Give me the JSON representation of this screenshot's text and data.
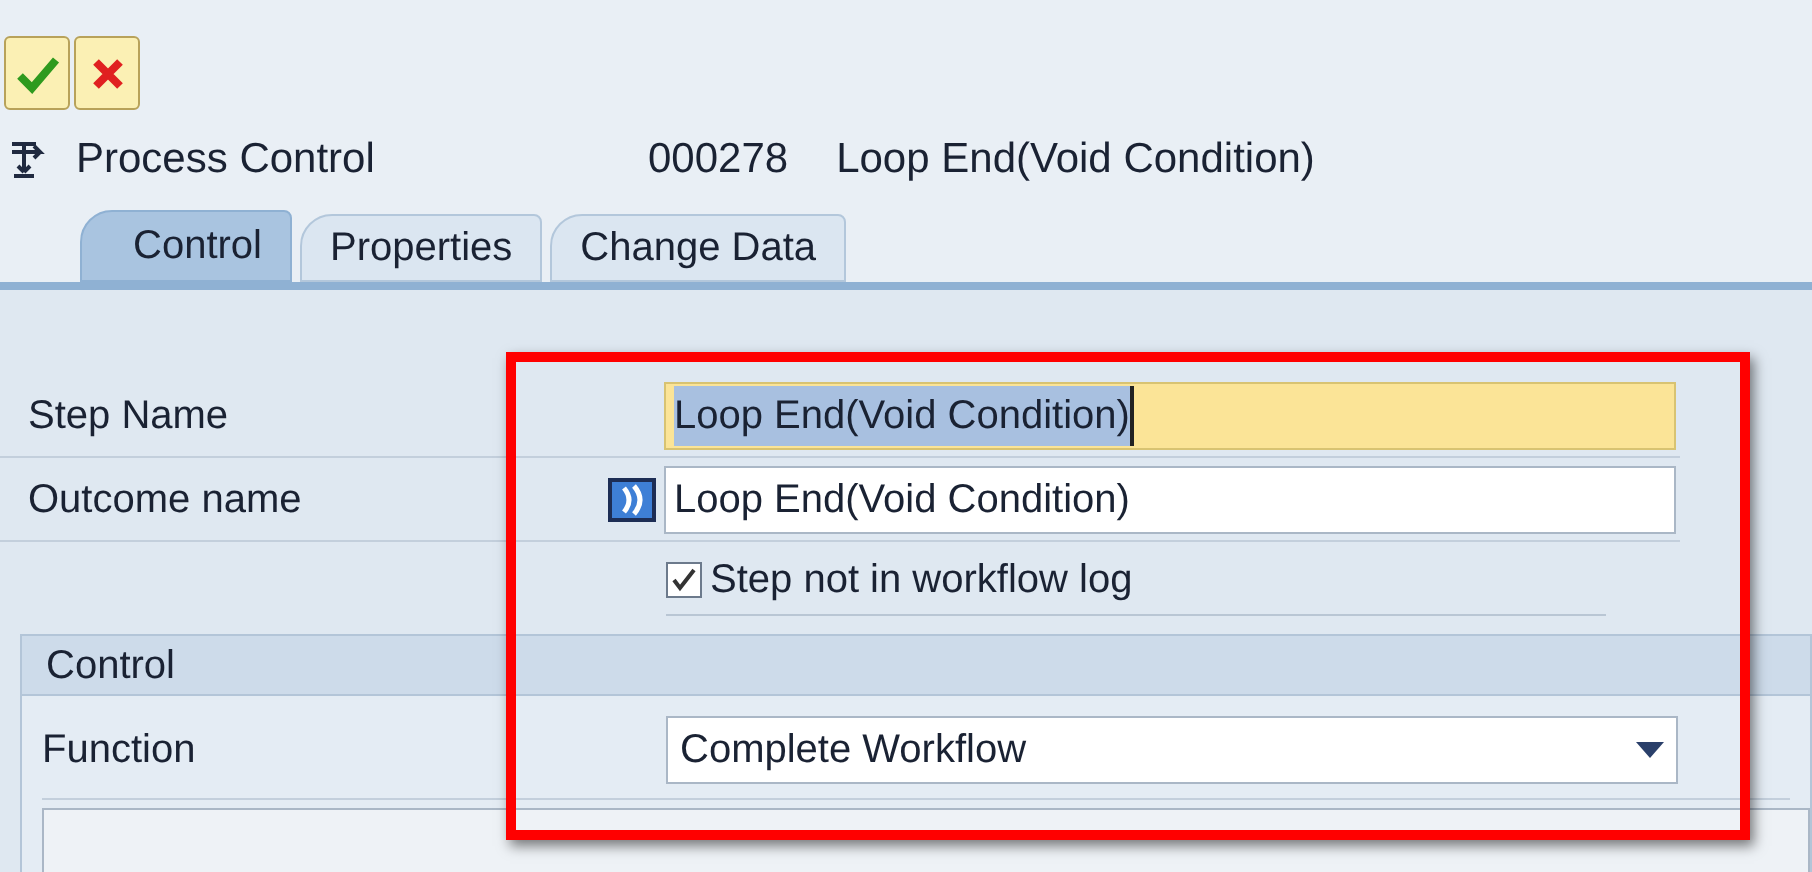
{
  "toolbar_buttons": [
    {
      "kind": "confirm"
    },
    {
      "kind": "cancel"
    }
  ],
  "header": {
    "title": "Process Control",
    "step_number": "000278",
    "step_title": "Loop End(Void Condition)"
  },
  "tabs": [
    {
      "label": "Control",
      "selected": true
    },
    {
      "label": "Properties",
      "selected": false
    },
    {
      "label": "Change Data",
      "selected": false
    }
  ],
  "fields": [
    {
      "label": "Step Name",
      "value": "Loop End(Void Condition)",
      "focused": true,
      "outcome_icon": false
    },
    {
      "label": "Outcome name",
      "value": "Loop End(Void Condition)",
      "focused": false,
      "outcome_icon": true
    }
  ],
  "checkbox": {
    "label": "Step not in workflow log",
    "checked": true
  },
  "group": {
    "title": "Control",
    "function_label": "Function",
    "function_value": "Complete Workflow"
  },
  "annotation": {
    "kind": "highlight_frame"
  }
}
